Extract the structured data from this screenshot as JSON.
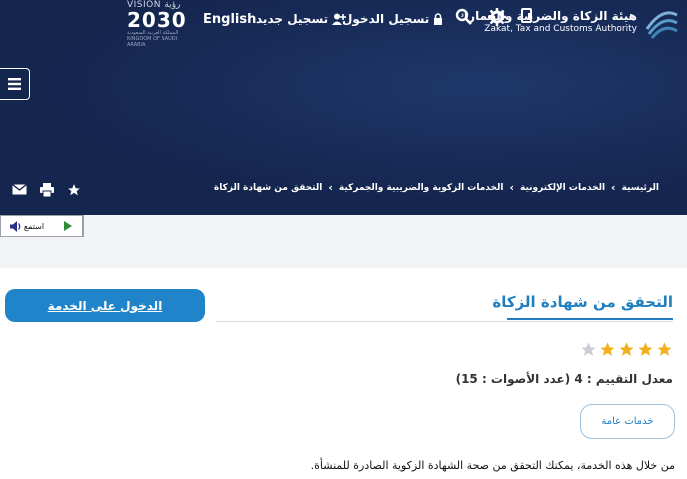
{
  "header": {
    "authority_name_ar": "هيئة الزكاة والضريبة والجمارك",
    "authority_name_en": "Zakat, Tax and Customs Authority",
    "vision": {
      "line1": "VISION رؤية",
      "year": "2030",
      "line3": "المملكة العربية السعودية KINGDOM OF SAUDI ARABIA"
    },
    "nav": {
      "login": "تسجيل الدخول",
      "register": "تسجيل جديد",
      "language": "English"
    }
  },
  "breadcrumb": {
    "items": [
      "الرئيسية",
      "الخدمات الإلكترونية",
      "الخدمات الزكوية والضريبية والجمركية",
      "التحقق من شهادة الزكاة"
    ]
  },
  "listen": {
    "label": "استمع"
  },
  "service": {
    "title": "التحقق من شهادة الزكاة",
    "access_button": "الدخول على الخدمة",
    "rating_text": "معدل التقييم : 4 (عدد الأصوات : 15)",
    "rating_value": 4,
    "rating_max": 5,
    "tag": "خدمات عامة",
    "description": "من خلال هذه الخدمة، يمكنك التحقق من صحة الشهادة الزكوية الصادرة للمنشأة."
  },
  "colors": {
    "hero_bg": "#14254e",
    "accent_blue": "#1f84c9",
    "star_filled": "#f2b01e",
    "star_empty": "#c9ccd1"
  },
  "icons": [
    "logo-mark-icon",
    "user-plus-icon",
    "lock-icon",
    "search-icon",
    "gear-icon",
    "user-icon",
    "menu-icon",
    "star-icon",
    "print-icon",
    "mail-icon",
    "play-icon",
    "speaker-icon",
    "chevron-left-icon"
  ]
}
